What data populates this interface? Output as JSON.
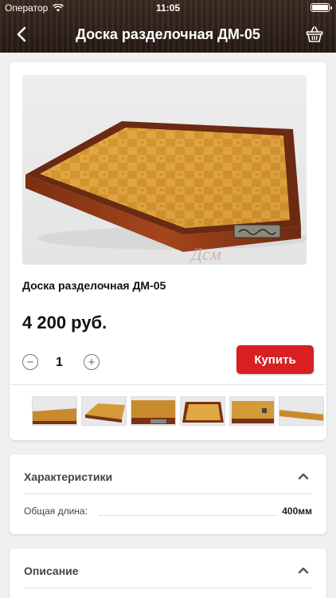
{
  "status_bar": {
    "carrier": "Оператор",
    "time": "11:05",
    "battery_level": 1.0
  },
  "nav": {
    "title": "Доска разделочная ДМ-05",
    "back_icon": "chevron-left-icon",
    "cart_icon": "basket-icon"
  },
  "product": {
    "name": "Доска разделочная ДМ-05",
    "price": "4 200 руб.",
    "quantity": "1",
    "buy_label": "Купить",
    "minus_icon": "minus-circle-icon",
    "plus_icon": "plus-circle-icon",
    "thumbnail_count": 6
  },
  "specs": {
    "title": "Характеристики",
    "rows": [
      {
        "label": "Общая длина:",
        "value": "400мм"
      }
    ]
  },
  "description": {
    "title": "Описание"
  },
  "colors": {
    "header_bg": "#2e2119",
    "buy_button": "#d71f24",
    "page_bg": "#f0f0f0"
  }
}
